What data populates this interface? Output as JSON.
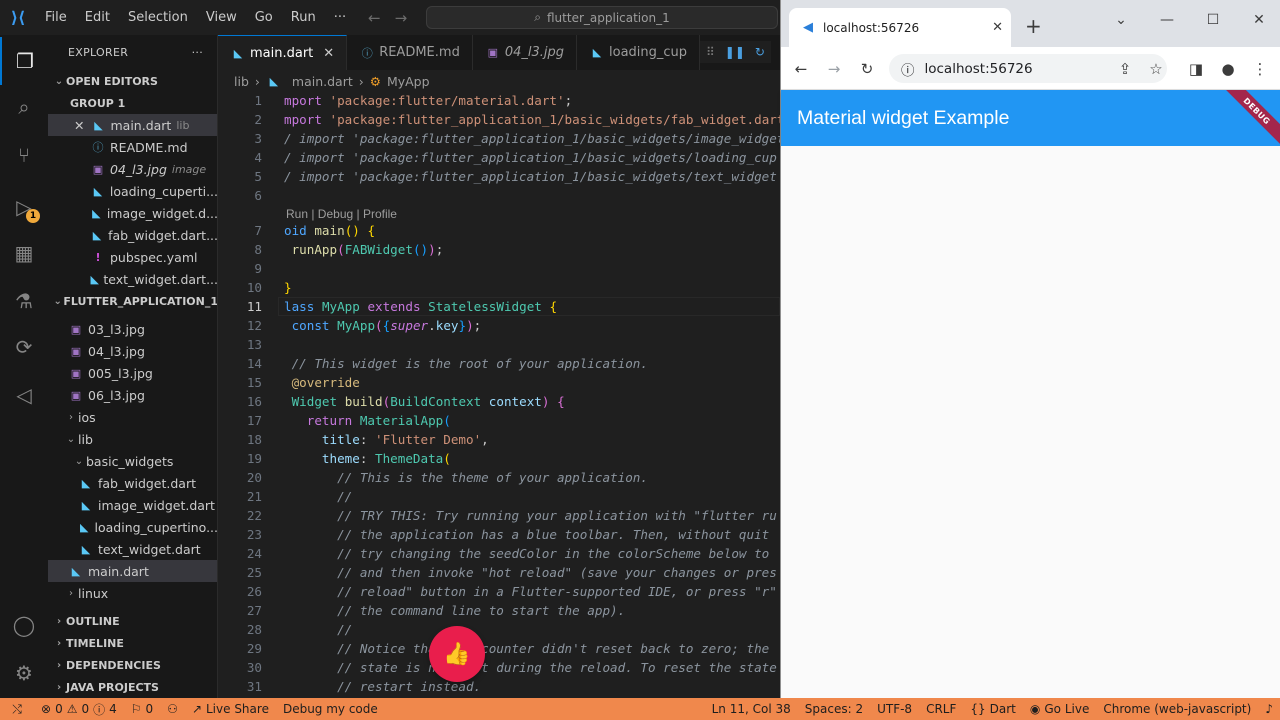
{
  "menu": [
    "File",
    "Edit",
    "Selection",
    "View",
    "Go",
    "Run",
    "···"
  ],
  "command_center": "flutter_application_1",
  "explorer": {
    "title": "EXPLORER",
    "open_editors": "OPEN EDITORS",
    "group": "GROUP 1",
    "open_files": [
      {
        "name": "main.dart",
        "hint": "lib",
        "icon": "dart"
      },
      {
        "name": "README.md",
        "hint": "",
        "icon": "md"
      },
      {
        "name": "04_l3.jpg",
        "hint": "image",
        "icon": "img"
      },
      {
        "name": "loading_cuperti...",
        "hint": "",
        "icon": "dart"
      },
      {
        "name": "image_widget.d...",
        "hint": "",
        "icon": "dart"
      },
      {
        "name": "fab_widget.dart...",
        "hint": "",
        "icon": "dart"
      },
      {
        "name": "pubspec.yaml",
        "hint": "",
        "icon": "yaml"
      },
      {
        "name": "text_widget.dart...",
        "hint": "",
        "icon": "dart"
      }
    ],
    "project": "FLUTTER_APPLICATION_1",
    "images": [
      "03_l3.jpg",
      "04_l3.jpg",
      "005_l3.jpg",
      "06_l3.jpg"
    ],
    "ios": "ios",
    "lib": "lib",
    "basic_widgets": "basic_widgets",
    "basic_files": [
      "fab_widget.dart",
      "image_widget.dart",
      "loading_cupertino...",
      "text_widget.dart"
    ],
    "main": "main.dart",
    "linux": "linux",
    "outline": "OUTLINE",
    "timeline": "TIMELINE",
    "dependencies": "DEPENDENCIES",
    "java_projects": "JAVA PROJECTS"
  },
  "tabs": [
    {
      "label": "main.dart",
      "icon": "dart"
    },
    {
      "label": "README.md",
      "icon": "md"
    },
    {
      "label": "04_l3.jpg",
      "icon": "img"
    },
    {
      "label": "loading_cup",
      "icon": "dart"
    }
  ],
  "breadcrumb": {
    "folder": "lib",
    "file": "main.dart",
    "symbol": "MyApp"
  },
  "codelens": "Run | Debug | Profile",
  "line_numbers": [
    "1",
    "2",
    "3",
    "4",
    "5",
    "6",
    "7",
    "8",
    "9",
    "10",
    "11",
    "12",
    "13",
    "14",
    "15",
    "16",
    "17",
    "18",
    "19",
    "20",
    "21",
    "22",
    "23",
    "24",
    "25",
    "26",
    "27",
    "28",
    "29",
    "30",
    "31"
  ],
  "current_line": "11",
  "code": {
    "l1_kw": "mport",
    "l1_str": "'package:flutter/material.dart'",
    "l2_kw": "mport",
    "l2_str": "'package:flutter_application_1/basic_widgets/fab_widget.dart'",
    "l3": "/ import 'package:flutter_application_1/basic_widgets/image_widget",
    "l4": "/ import 'package:flutter_application_1/basic_widgets/loading_cup",
    "l5": "/ import 'package:flutter_application_1/basic_widgets/text_widget",
    "l7_kw": "oid",
    "l7_fn": "main",
    "l8_fn": "runApp",
    "l8_cls": "FABWidget",
    "l10": "}",
    "l11_kw": "lass",
    "l11_cls": "MyApp",
    "l11_ext": "extends",
    "l11_sup": "StatelessWidget",
    "l12_kw": "const",
    "l12_cls": "MyApp",
    "l12_super": "super",
    "l12_key": "key",
    "l14": "// This widget is the root of your application.",
    "l15": "@override",
    "l16_cls": "Widget",
    "l16_fn": "build",
    "l16_ctx": "BuildContext",
    "l16_prm": "context",
    "l17_kw": "return",
    "l17_cls": "MaterialApp",
    "l18_key": "title",
    "l18_str": "'Flutter Demo'",
    "l19_key": "theme",
    "l19_cls": "ThemeData",
    "l20": "// This is the theme of your application.",
    "l21": "//",
    "l22": "// TRY THIS: Try running your application with \"flutter ru",
    "l23": "// the application has a blue toolbar. Then, without quit",
    "l24": "// try changing the seedColor in the colorScheme below to",
    "l25": "// and then invoke \"hot reload\" (save your changes or pres",
    "l26": "// reload\" button in a Flutter-supported IDE, or press \"r\"",
    "l27": "// the command line to start the app).",
    "l28": "//",
    "l29": "// Notice that the counter didn't reset back to zero; the",
    "l30": "// state is not lost during the reload. To reset the state",
    "l31": "// restart instead."
  },
  "status": {
    "errors": "0",
    "warnings": "0",
    "info": "4",
    "ports": "0",
    "live_share": "Live Share",
    "debug": "Debug my code",
    "position": "Ln 11, Col 38",
    "spaces": "Spaces: 2",
    "encoding": "UTF-8",
    "eol": "CRLF",
    "language": "Dart",
    "go_live": "Go Live",
    "device": "Chrome (web-javascript)"
  },
  "browser": {
    "tab_title": "localhost:56726",
    "url": "localhost:56726",
    "app_title": "Material widget Example",
    "ribbon": "DEBUG"
  },
  "colors": {
    "status_bar": "#f0884c",
    "app_bar": "#2196f3",
    "fab": "#e91e4c",
    "accent": "#0078d4"
  }
}
